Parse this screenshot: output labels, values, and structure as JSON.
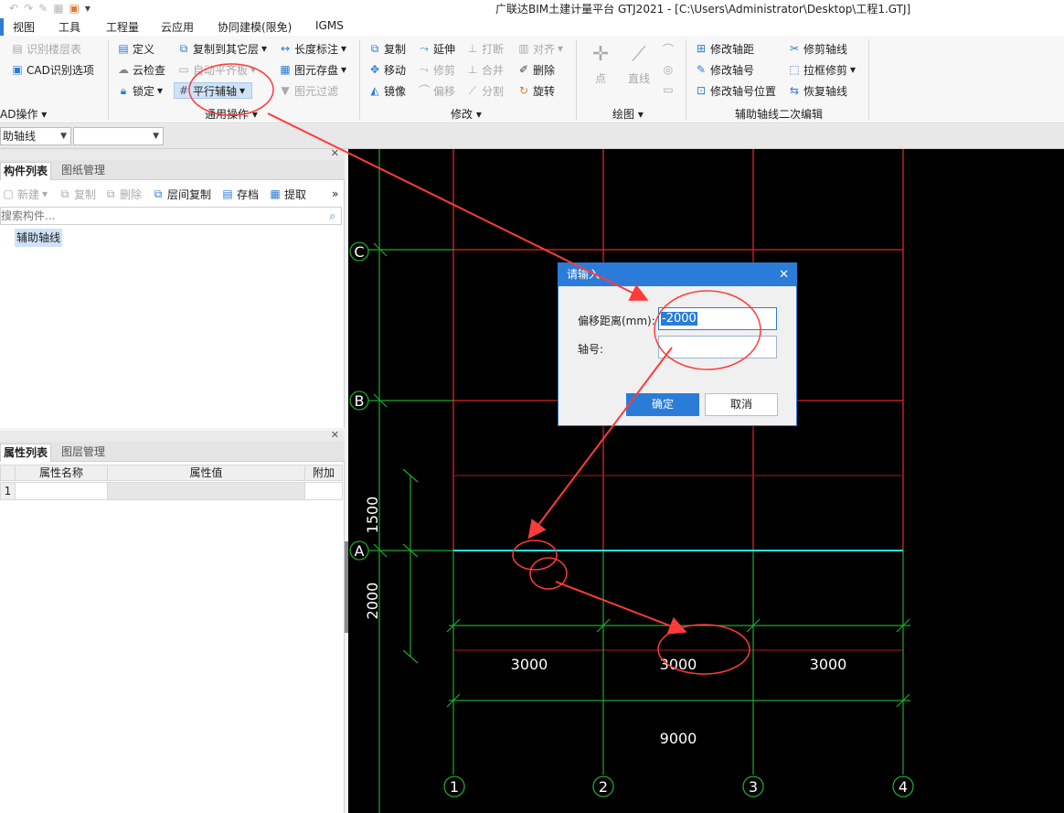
{
  "titlebar": {
    "title": "广联达BIM土建计量平台 GTJ2021 - [C:\\Users\\Administrator\\Desktop\\工程1.GTJ]"
  },
  "menu": [
    "视图",
    "工具",
    "工程量",
    "云应用",
    "协同建模(限免)",
    "IGMS"
  ],
  "ribbon": {
    "cad_group": {
      "items": [
        "识别楼层表",
        "CAD识别选项"
      ],
      "label": "AD操作"
    },
    "general": {
      "col1": [
        "定义",
        "云检查",
        "锁定"
      ],
      "col2": [
        "复制到其它层",
        "自动平齐板",
        "平行辅轴"
      ],
      "col3": [
        "长度标注",
        "图元存盘",
        "图元过滤"
      ],
      "label": "通用操作"
    },
    "modify": {
      "col1": [
        "复制",
        "移动",
        "镜像"
      ],
      "col2": [
        "延伸",
        "修剪",
        "偏移"
      ],
      "col3": [
        "打断",
        "合并",
        "分割"
      ],
      "col4": [
        "对齐",
        "删除",
        "旋转"
      ],
      "label": "修改"
    },
    "draw": {
      "items": [
        "点",
        "直线"
      ],
      "label": "绘图"
    },
    "axis": {
      "col1": [
        "修改轴距",
        "修改轴号",
        "修改轴号位置"
      ],
      "col2": [
        "修剪轴线",
        "拉框修剪",
        "恢复轴线"
      ],
      "label": "辅助轴线二次编辑"
    }
  },
  "selector": {
    "value1": "助轴线",
    "value2": ""
  },
  "component_panel": {
    "tabs": [
      "构件列表",
      "图纸管理"
    ],
    "toolbar": [
      "新建",
      "复制",
      "删除",
      "层间复制",
      "存档",
      "提取"
    ],
    "search_placeholder": "搜索构件...",
    "tree_item": "辅助轴线"
  },
  "property_panel": {
    "tabs": [
      "属性列表",
      "图层管理"
    ],
    "columns": [
      "属性名称",
      "属性值",
      "附加"
    ],
    "row_number": "1"
  },
  "canvas": {
    "axis_labels_row": [
      "C",
      "B",
      "A"
    ],
    "axis_labels_col": [
      "1",
      "2",
      "3",
      "4"
    ],
    "dims": {
      "d1500": "1500",
      "d2000": "2000",
      "d3000a": "3000",
      "d3000b": "3000",
      "d3000c": "3000",
      "d9000": "9000"
    }
  },
  "dialog": {
    "title": "请输入",
    "offset_label": "偏移距离(mm):",
    "offset_value": "-2000",
    "axis_label": "轴号:",
    "axis_value": "",
    "ok": "确定",
    "cancel": "取消"
  }
}
